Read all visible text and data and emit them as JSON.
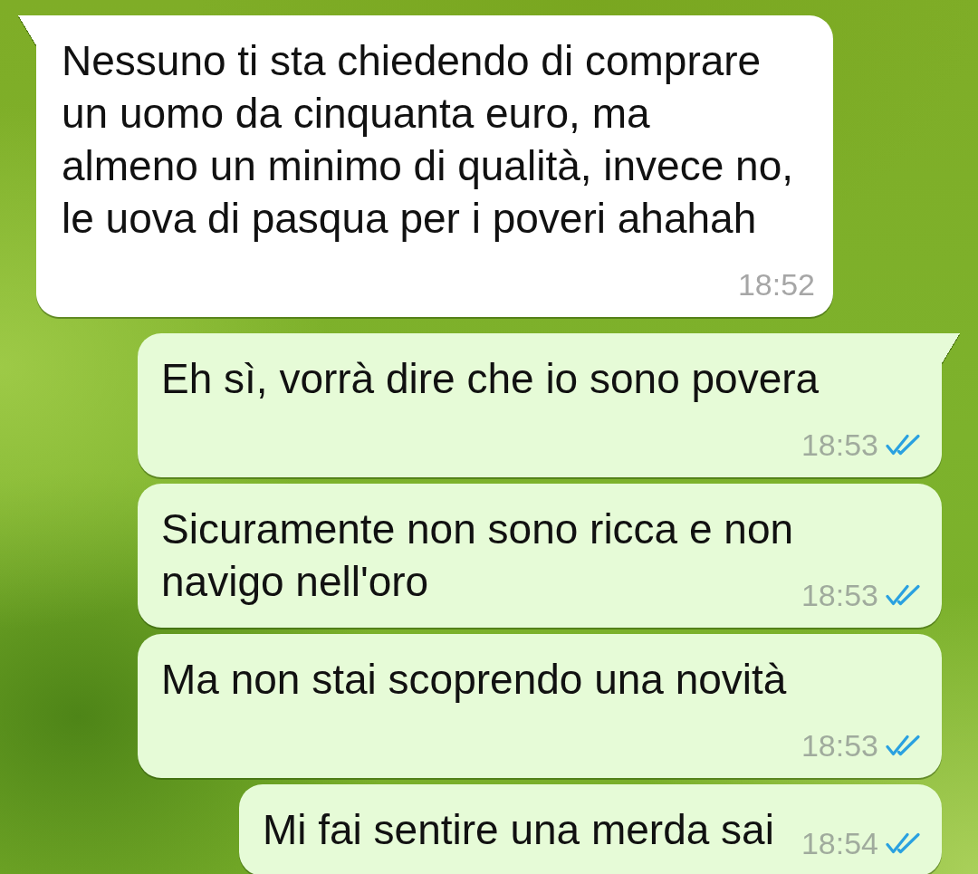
{
  "messages": [
    {
      "kind": "incoming",
      "text": "Nessuno ti sta chiedendo di comprare un uomo da cinquanta euro, ma almeno un minimo di qualità, invece no, le uova di pasqua per i poveri ahahah",
      "time": "18:52"
    },
    {
      "kind": "outgoing",
      "text": "Eh sì, vorrà dire che io sono povera",
      "time": "18:53",
      "read": true
    },
    {
      "kind": "outgoing",
      "text": "Sicuramente non sono ricca e non navigo nell'oro",
      "time": "18:53",
      "read": true
    },
    {
      "kind": "outgoing",
      "text": "Ma non stai scoprendo una novità",
      "time": "18:53",
      "read": true
    },
    {
      "kind": "outgoing",
      "text": "Mi fai sentire una merda sai",
      "time": "18:54",
      "read": true
    }
  ]
}
